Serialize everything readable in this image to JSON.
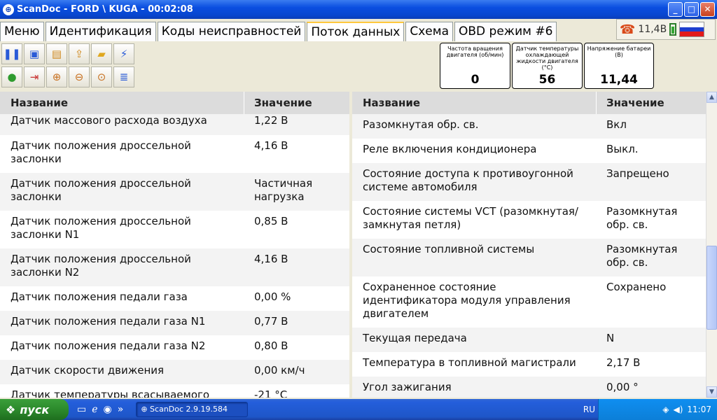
{
  "window": {
    "title": "ScanDoc - FORD \\ KUGA - 00:02:08",
    "app_icon": "steering-wheel-icon",
    "minimize": "_",
    "maximize": "□",
    "close": "✕"
  },
  "tabs": [
    {
      "label": "Меню"
    },
    {
      "label": "Идентификация"
    },
    {
      "label": "Коды неисправностей"
    },
    {
      "label": "Поток данных",
      "active": true
    },
    {
      "label": "Схема"
    },
    {
      "label": "OBD режим #6"
    }
  ],
  "status": {
    "voltage": "11,4В",
    "phone_icon": "phone-icon",
    "battery_icon": "battery-icon",
    "flag_colors": [
      "#ffffff",
      "#1f3fcf",
      "#e21a1a"
    ]
  },
  "toolbar": {
    "row1": [
      "pause-icon",
      "save-icon",
      "print-icon",
      "export-icon",
      "folder-icon",
      "connect-icon"
    ],
    "row2": [
      "leaf-icon",
      "exit-icon",
      "zoom-in-icon",
      "zoom-out-icon",
      "zoom-fit-icon",
      "list-icon"
    ]
  },
  "gauges": [
    {
      "caption": "Частота вращения двигателя (об/мин)",
      "value": "0"
    },
    {
      "caption": "Датчик температуры охлаждающей жидкости двигателя (°С)",
      "value": "56"
    },
    {
      "caption": "Напряжение батареи (В)",
      "value": "11,44"
    }
  ],
  "table_left": {
    "col_name": "Название",
    "col_value": "Значение",
    "rows": [
      {
        "name": "Датчик массового расхода воздуха",
        "value": "1,22 В"
      },
      {
        "name": "Датчик положения дроссельной заслонки",
        "value": "4,16 В"
      },
      {
        "name": "Датчик положения дроссельной заслонки",
        "value": "Частичная нагрузка"
      },
      {
        "name": "Датчик положения дроссельной заслонки N1",
        "value": "0,85 В"
      },
      {
        "name": "Датчик положения дроссельной заслонки N2",
        "value": "4,16 В"
      },
      {
        "name": "Датчик положения педали газа",
        "value": "0,00 %"
      },
      {
        "name": "Датчик положения педали газа N1",
        "value": "0,77 В"
      },
      {
        "name": "Датчик положения педали газа N2",
        "value": "0,80 В"
      },
      {
        "name": "Датчик скорости движения",
        "value": "0,00 км/ч"
      },
      {
        "name": "Датчик температуры всасываемого",
        "value": "-21 °C"
      }
    ]
  },
  "table_right": {
    "col_name": "Название",
    "col_value": "Значение",
    "rows": [
      {
        "name": "Разомкнутая обр. св.",
        "value": "Вкл"
      },
      {
        "name": "Реле включения кондиционера",
        "value": "Выкл."
      },
      {
        "name": "Состояние доступа к противоугонной системе автомобиля",
        "value": "Запрещено"
      },
      {
        "name": "Состояние системы VCT (разомкнутая/замкнутая петля)",
        "value": "Разомкнутая обр. св."
      },
      {
        "name": "Состояние топливной системы",
        "value": "Разомкнутая обр. св."
      },
      {
        "name": "Сохраненное состояние идентификатора модуля управления двигателем",
        "value": "Сохранено"
      },
      {
        "name": "Текущая передача",
        "value": "N"
      },
      {
        "name": "Температура в топливной магистрали",
        "value": "2,17 В"
      },
      {
        "name": "Угол зажигания",
        "value": "0,00 °"
      }
    ]
  },
  "taskbar": {
    "start_label": "пуск",
    "task_label": "ScanDoc 2.9.19.584",
    "lang": "RU",
    "time": "11:07",
    "quick_icons": [
      "show-desktop-icon",
      "ie-icon",
      "media-player-icon"
    ],
    "more": "»"
  }
}
